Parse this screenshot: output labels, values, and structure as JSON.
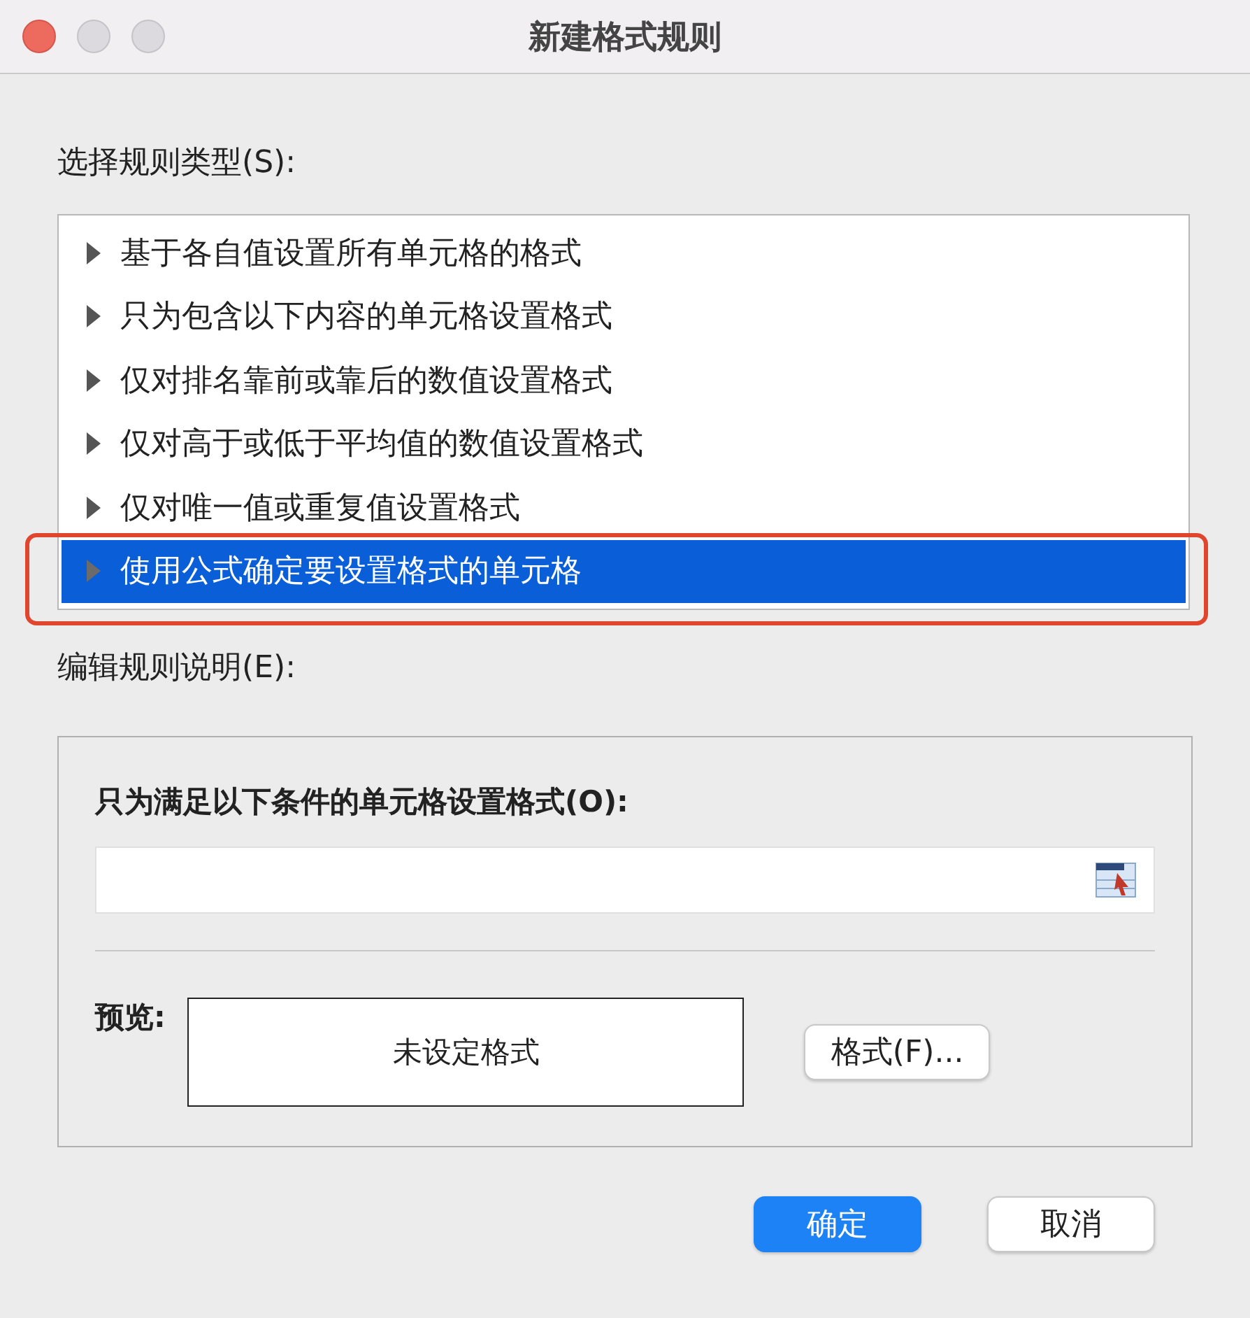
{
  "window": {
    "title": "新建格式规则"
  },
  "rule_type": {
    "label": "选择规则类型(S):",
    "items": [
      {
        "label": "基于各自值设置所有单元格的格式",
        "selected": false
      },
      {
        "label": "只为包含以下内容的单元格设置格式",
        "selected": false
      },
      {
        "label": "仅对排名靠前或靠后的数值设置格式",
        "selected": false
      },
      {
        "label": "仅对高于或低于平均值的数值设置格式",
        "selected": false
      },
      {
        "label": "仅对唯一值或重复值设置格式",
        "selected": false
      },
      {
        "label": "使用公式确定要设置格式的单元格",
        "selected": true
      }
    ]
  },
  "edit": {
    "label": "编辑规则说明(E):",
    "condition_label": "只为满足以下条件的单元格设置格式(O):",
    "preview_label": "预览:",
    "preview_text": "未设定格式",
    "format_button": "格式(F)..."
  },
  "buttons": [
    {
      "label": "确定",
      "default": true
    },
    {
      "label": "取消",
      "default": false
    }
  ]
}
